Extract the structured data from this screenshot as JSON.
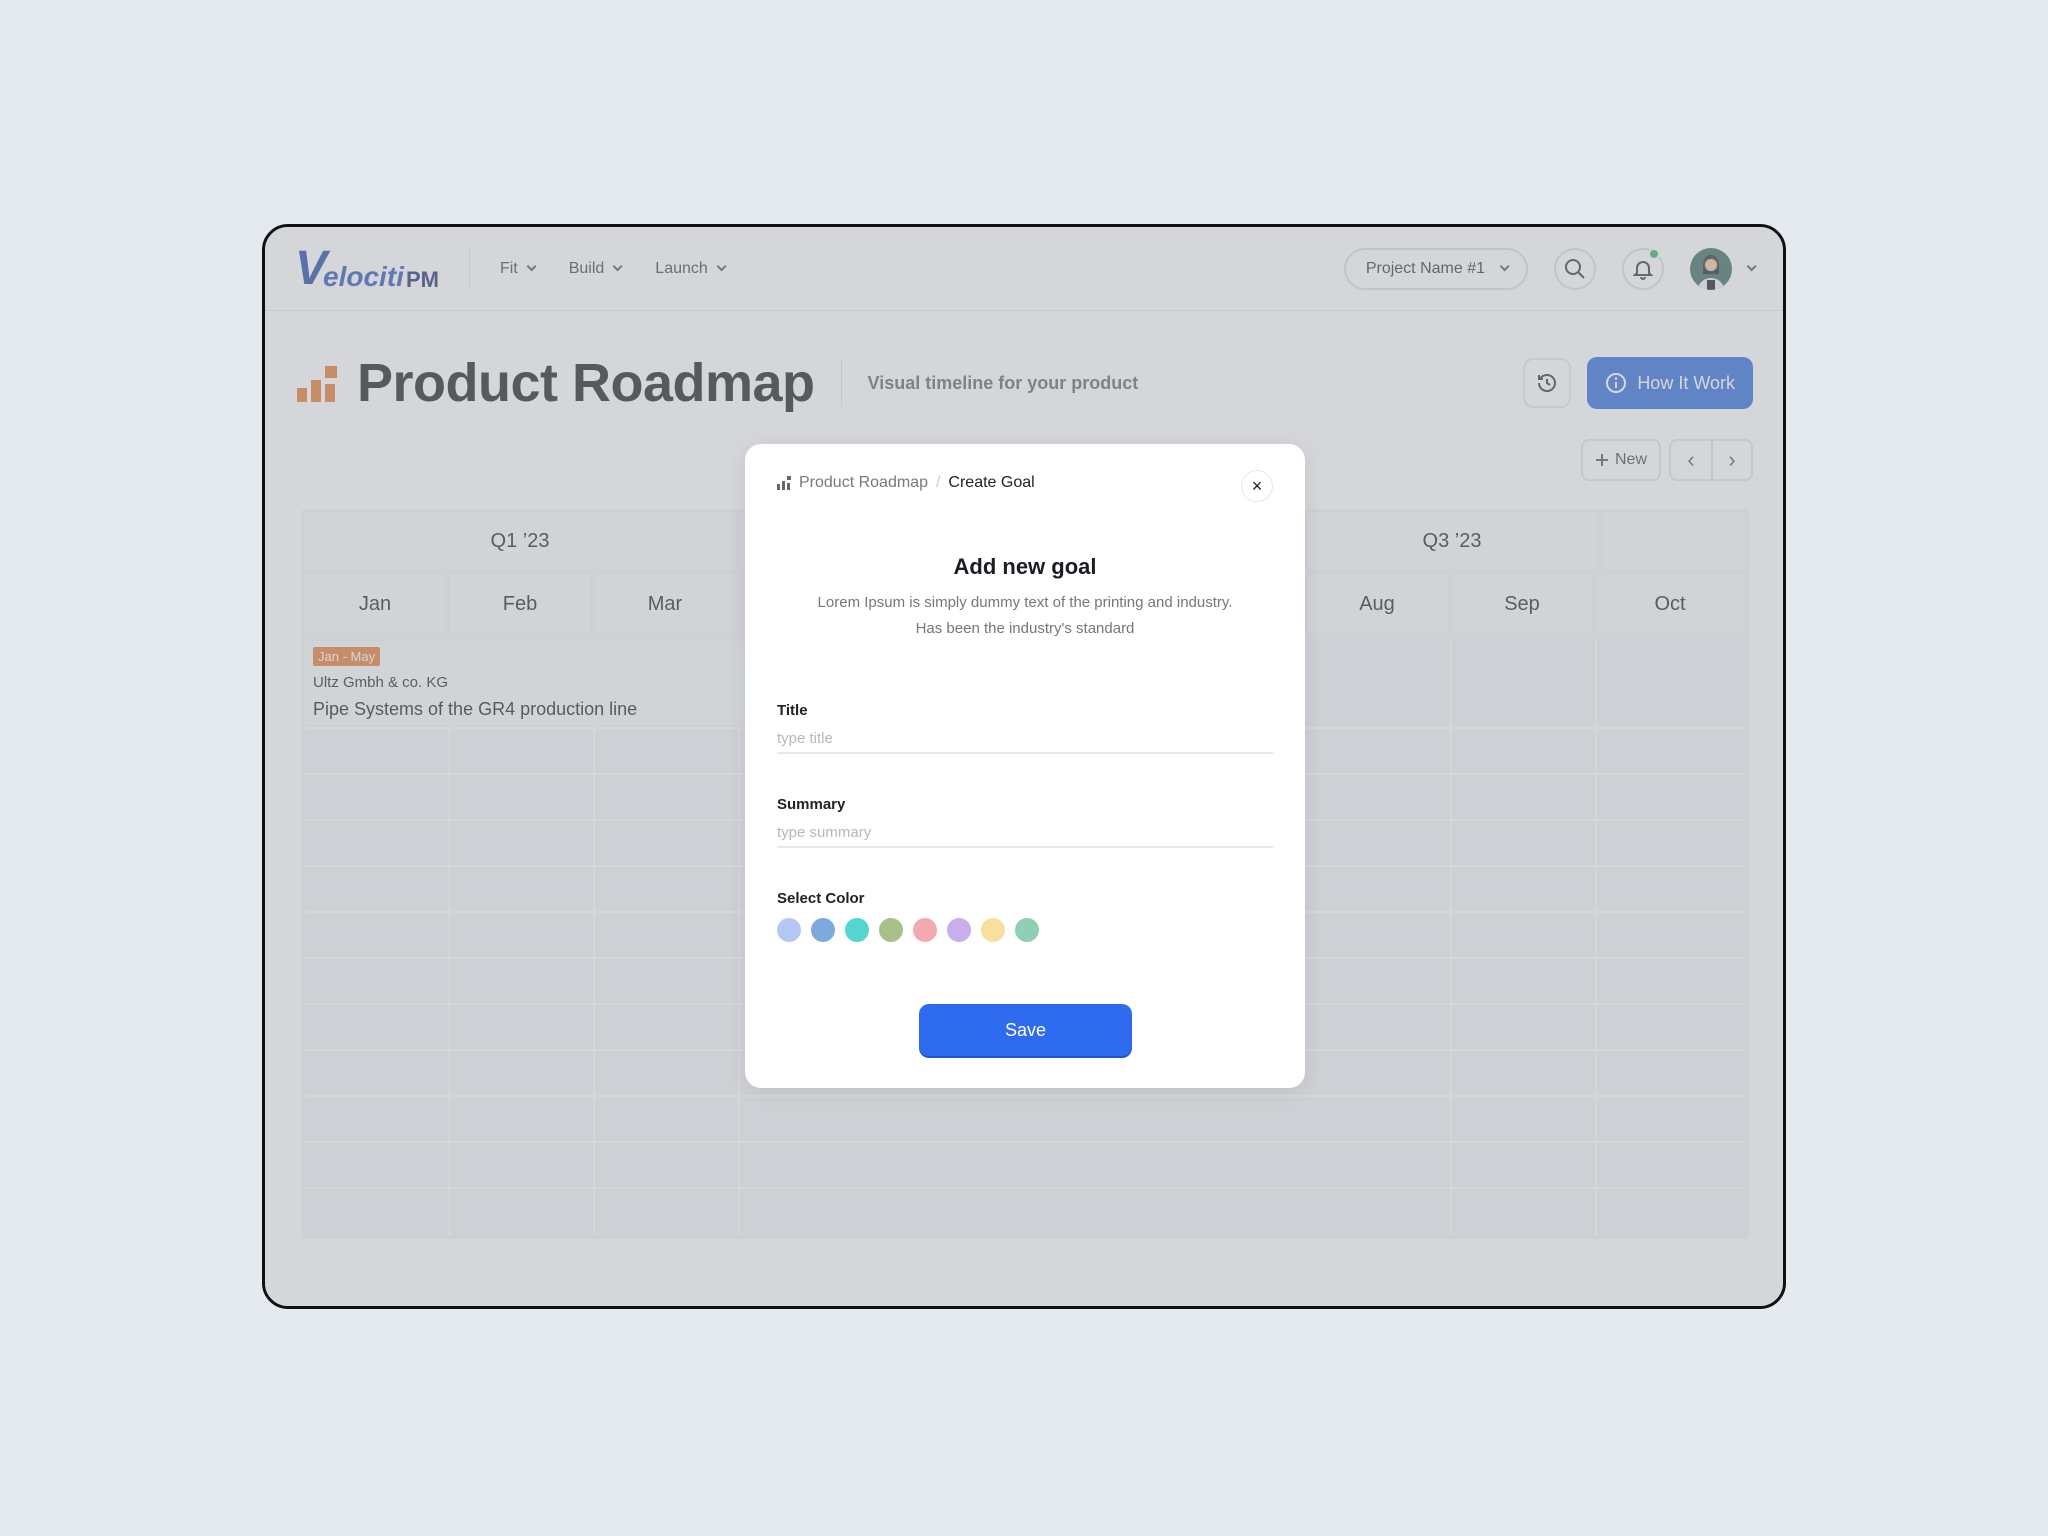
{
  "app": {
    "logo_v": "V",
    "logo_rest": "elociti",
    "logo_pm": "PM"
  },
  "nav": [
    {
      "label": "Fit"
    },
    {
      "label": "Build"
    },
    {
      "label": "Launch"
    }
  ],
  "header": {
    "project": "Project Name #1",
    "icons": [
      "search-icon",
      "bell-icon",
      "avatar"
    ]
  },
  "page": {
    "title": "Product Roadmap",
    "subtitle": "Visual timeline for your product",
    "how_label": "How It Work"
  },
  "toolbar": {
    "new_label": "New",
    "prev": "‹",
    "next": "›"
  },
  "roadmap": {
    "quarters": [
      "Q1 ’23",
      "Q3 ’23"
    ],
    "months": [
      "Jan",
      "Feb",
      "Mar",
      "Aug",
      "Sep",
      "Oct"
    ],
    "goal": {
      "badge": "Jan - May",
      "company": "Ultz Gmbh & co. KG",
      "title": "Pipe Systems of the GR4 production line"
    }
  },
  "modal": {
    "breadcrumb_root": "Product Roadmap",
    "breadcrumb_sep": "/",
    "breadcrumb_current": "Create Goal",
    "close": "×",
    "heading": "Add new goal",
    "description": "Lorem Ipsum is simply dummy text of the printing and industry. Has been the industry's standard",
    "title_label": "Title",
    "title_placeholder": "type title",
    "title_value": "",
    "summary_label": "Summary",
    "summary_placeholder": "type summary",
    "summary_value": "",
    "color_label": "Select Color",
    "colors": [
      "#b7c7f4",
      "#7ea9dc",
      "#56d4d1",
      "#a8c08a",
      "#f2aab0",
      "#c8aeea",
      "#f8dfa0",
      "#8fd0b4"
    ],
    "save_label": "Save"
  },
  "colors": {
    "accent": "#2f6bef",
    "badge": "#e87a33",
    "brand": "#2146a8",
    "notif": "#2fb468"
  }
}
